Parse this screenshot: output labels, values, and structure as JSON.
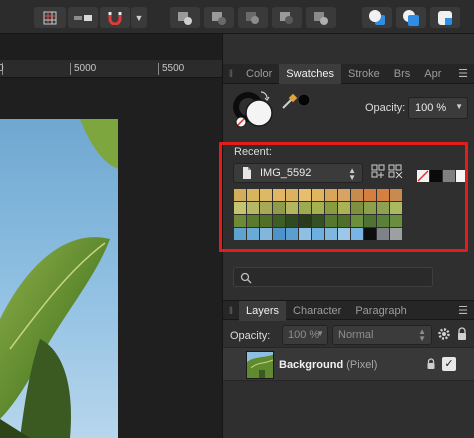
{
  "ruler": {
    "labels": [
      "5000",
      "5500"
    ]
  },
  "panel": {
    "tabs": [
      "Color",
      "Swatches",
      "Stroke",
      "Brs",
      "Apr"
    ],
    "active_tab": "Swatches",
    "opacity_label": "Opacity:",
    "opacity_value": "100 %",
    "recent_label": "Recent:",
    "palette_name": "IMG_5592",
    "swatch_rows": [
      [
        "#d4ad5a",
        "#d8b55d",
        "#ddb866",
        "#e1b765",
        "#dcb25f",
        "#e6be6e",
        "#e0b55d",
        "#d8a658",
        "#d8a462",
        "#c78a4f",
        "#d67e3f",
        "#d58041",
        "#c98a50"
      ],
      [
        "#c7c46f",
        "#b6b865",
        "#a7a956",
        "#8f9b49",
        "#b2b65e",
        "#9eaa50",
        "#a4b14f",
        "#8a9c40",
        "#a9b255",
        "#7f9040",
        "#8aa04a",
        "#8ea052",
        "#aab861"
      ],
      [
        "#6e8a36",
        "#5b7a2e",
        "#50702a",
        "#3f5e24",
        "#2f4a20",
        "#2a3a1c",
        "#345124",
        "#56782e",
        "#4f6e2b",
        "#6b8f3a",
        "#4f7335",
        "#5b803a",
        "#6a8e40"
      ],
      [
        "#5ea2cf",
        "#6aaad6",
        "#82b6dc",
        "#4e93c8",
        "#5b9fd0",
        "#8fc0e4",
        "#6bb0e0",
        "#7fb7de",
        "#9cc8e8",
        "#7ab4e2",
        "#0e0e0e",
        "#7f8288",
        "#9da0a3"
      ]
    ],
    "search_placeholder": "",
    "layers_tabs": [
      "Layers",
      "Character",
      "Paragraph"
    ],
    "active_layers_tab": "Layers",
    "layer_opacity_label": "Opacity:",
    "layer_opacity_value": "100 %",
    "blend_mode": "Normal",
    "layer": {
      "name": "Background",
      "type": "(Pixel)",
      "visible": true
    }
  },
  "colors": {
    "highlight": "#e31c1c",
    "panel_bg": "#2f2f2f",
    "toolbar_bg": "#2c2c2c"
  }
}
